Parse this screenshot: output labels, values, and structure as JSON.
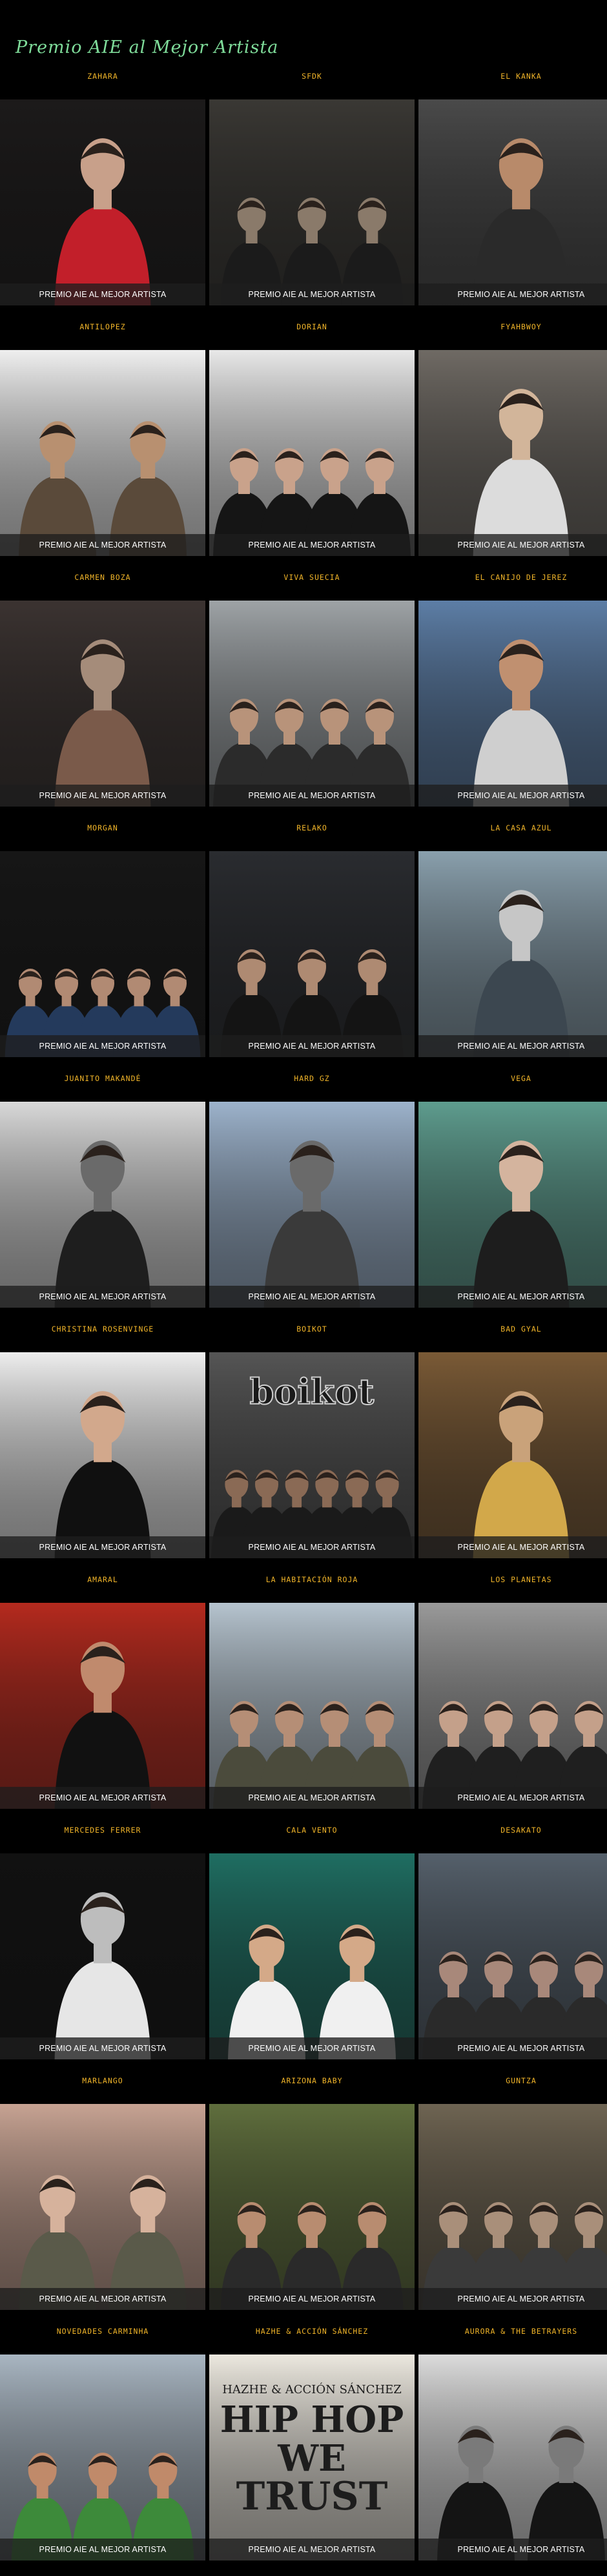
{
  "page": {
    "title": "Premio AIE al Mejor Artista"
  },
  "award_label": "PREMIO AIE AL MEJOR ARTISTA",
  "artists": [
    {
      "name": "ZAHARA",
      "bg": "#1c1a1a",
      "fg": "#c8a08a",
      "accent": "#c21f2a"
    },
    {
      "name": "SFDK",
      "bg": "#3a3834",
      "fg": "#8a7a6a",
      "accent": "#1b1b1b"
    },
    {
      "name": "EL KANKA",
      "bg": "#4a4a4a",
      "fg": "#b88a6a",
      "accent": "#2a2a2a"
    },
    {
      "name": "ANTILOPEZ",
      "bg": "#efefef",
      "fg": "#b89070",
      "accent": "#5a4a3a"
    },
    {
      "name": "DORIAN",
      "bg": "#e8e8e8",
      "fg": "#c9a28b",
      "accent": "#151515"
    },
    {
      "name": "FYAHBWOY",
      "bg": "#6f6a64",
      "fg": "#d2b59a",
      "accent": "#dcdcdc"
    },
    {
      "name": "CARMEN BOZA",
      "bg": "#3b3331",
      "fg": "#a58c7a",
      "accent": "#7a5a4a"
    },
    {
      "name": "VIVA SUECIA",
      "bg": "#9ea3a6",
      "fg": "#b8937a",
      "accent": "#2b2b2b"
    },
    {
      "name": "EL CANIJO DE JEREZ",
      "bg": "#5d7ea6",
      "fg": "#c09070",
      "accent": "#cfcfcf"
    },
    {
      "name": "MORGAN",
      "bg": "#161616",
      "fg": "#b18a73",
      "accent": "#243a5c"
    },
    {
      "name": "RELAKO",
      "bg": "#2a2c30",
      "fg": "#ae8a72",
      "accent": "#141414"
    },
    {
      "name": "LA CASA AZUL",
      "bg": "#8aa0ad",
      "fg": "#c6c6c6",
      "accent": "#3c4750"
    },
    {
      "name": "JUANITO MAKANDÉ",
      "bg": "#d9d9d9",
      "fg": "#6a6a6a",
      "accent": "#1e1e1e"
    },
    {
      "name": "HARD GZ",
      "bg": "#9db3cc",
      "fg": "#6a6a6a",
      "accent": "#3a3a3a"
    },
    {
      "name": "VEGA",
      "bg": "#5e9c8e",
      "fg": "#d4b49e",
      "accent": "#1d1d1d"
    },
    {
      "name": "CHRISTINA ROSENVINGE",
      "bg": "#eeeeee",
      "fg": "#d2a88c",
      "accent": "#101010"
    },
    {
      "name": "BOIKOT",
      "bg": "#555555",
      "fg": "#8a6a55",
      "accent": "#1a1a1a"
    },
    {
      "name": "BAD GYAL",
      "bg": "#7a5a36",
      "fg": "#c9a27a",
      "accent": "#d2a84a"
    },
    {
      "name": "AMARAL",
      "bg": "#b52a1e",
      "fg": "#c08a6d",
      "accent": "#111111"
    },
    {
      "name": "LA HABITACIÓN ROJA",
      "bg": "#b6c4cf",
      "fg": "#b58e76",
      "accent": "#4b4b3c"
    },
    {
      "name": "LOS PLANETAS",
      "bg": "#9a9a9a",
      "fg": "#c4a08a",
      "accent": "#1f1f1f"
    },
    {
      "name": "MERCEDES FERRER",
      "bg": "#111111",
      "fg": "#bdbdbd",
      "accent": "#e6e6e6"
    },
    {
      "name": "CALA VENTO",
      "bg": "#1f6e62",
      "fg": "#d4a988",
      "accent": "#f0f0f0"
    },
    {
      "name": "DESAKATO",
      "bg": "#55606b",
      "fg": "#a8887a",
      "accent": "#2a2a2a"
    },
    {
      "name": "MARLANGO",
      "bg": "#c7a393",
      "fg": "#d6b29c",
      "accent": "#5a5a4a"
    },
    {
      "name": "ARIZONA BABY",
      "bg": "#5f6e3d",
      "fg": "#b88c70",
      "accent": "#2a2a2a"
    },
    {
      "name": "GUNTZA",
      "bg": "#6e6452",
      "fg": "#a98f7a",
      "accent": "#3a3a3a"
    },
    {
      "name": "NOVEDADES CARMINHA",
      "bg": "#a9b6c2",
      "fg": "#c08a6a",
      "accent": "#3d8a3a"
    },
    {
      "name": "HAZHE & ACCIÓN SÁNCHEZ",
      "bg": "#ece8df",
      "fg": "#2a2a2a",
      "accent": "#cfcac0"
    },
    {
      "name": "AURORA & THE BETRAYERS",
      "bg": "#dcdcdc",
      "fg": "#7a7a7a",
      "accent": "#141414"
    }
  ],
  "cover_texts": {
    "hazhe_header": "HAZHE & ACCIÓN SÁNCHEZ",
    "hazhe_line1": "HIP HOP",
    "hazhe_line2": "WE",
    "hazhe_line3": "TRUST",
    "boikot_logo": "boikot"
  }
}
